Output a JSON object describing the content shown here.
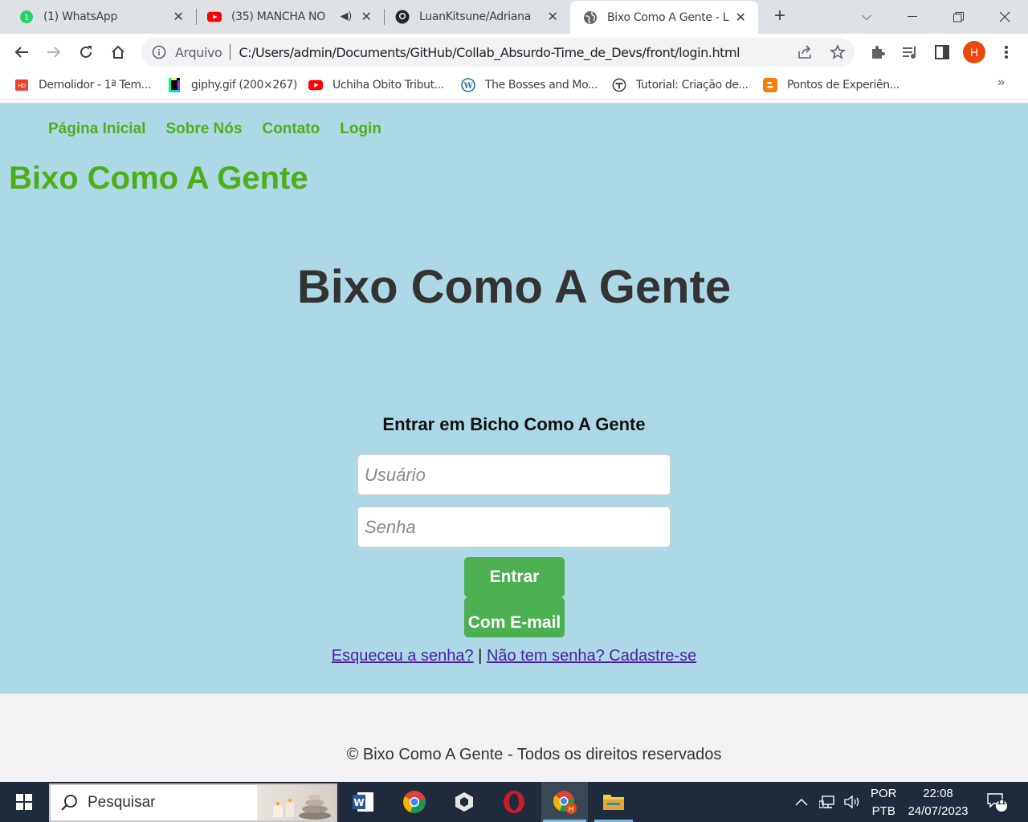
{
  "browser": {
    "tabs": [
      {
        "title": "(1) WhatsApp",
        "icon": "whatsapp-icon",
        "active": false
      },
      {
        "title": "(35) MANCHA NO",
        "icon": "youtube-icon",
        "active": false
      },
      {
        "title": "LuanKitsune/Adriana",
        "icon": "github-icon",
        "active": false
      },
      {
        "title": "Bixo Como A Gente - L",
        "icon": "globe-icon",
        "active": true
      }
    ],
    "address": {
      "scheme_label": "Arquivo",
      "url": "C:/Users/admin/Documents/GitHub/Collab_Absurdo-Time_de_Devs/front/login.html"
    },
    "profile_initial": "H",
    "bookmarks": [
      {
        "label": "Demolidor - 1ª Tem...",
        "icon": "hd-video-icon"
      },
      {
        "label": "giphy.gif (200×267)",
        "icon": "giphy-icon"
      },
      {
        "label": "Uchiha Obito Tribut...",
        "icon": "youtube-icon"
      },
      {
        "label": "The Bosses and Mo...",
        "icon": "wordpress-icon"
      },
      {
        "label": "Tutorial: Criação de...",
        "icon": "tutorial-icon"
      },
      {
        "label": "Pontos de Experiên...",
        "icon": "blogger-icon"
      }
    ],
    "bookmarks_more": "»"
  },
  "page": {
    "nav": [
      "Página Inicial",
      "Sobre Nós",
      "Contato",
      "Login"
    ],
    "brand": "Bixo Como A Gente",
    "hero_title": "Bixo Como A Gente",
    "login": {
      "title": "Entrar em Bicho Como A Gente",
      "username_placeholder": "Usuário",
      "password_placeholder": "Senha",
      "submit_label": "Entrar",
      "email_label": "Com E-mail",
      "forgot_link": "Esqueceu a senha?",
      "separator": "|",
      "signup_link": "Não tem senha? Cadastre-se"
    },
    "footer": "© Bixo Como A Gente - Todos os direitos reservados"
  },
  "taskbar": {
    "search_placeholder": "Pesquisar",
    "apps": [
      "word-icon",
      "chrome-icon",
      "unity-icon",
      "opera-icon",
      "chrome-profile-icon",
      "file-explorer-icon"
    ],
    "lang_line1": "POR",
    "lang_line2": "PTB",
    "time": "22:08",
    "date": "24/07/2023",
    "notification_count": "11"
  },
  "colors": {
    "page_bg": "#add8e6",
    "accent_green": "#4caf1a",
    "button_green": "#4caf50",
    "footer_bg": "#f2f2f2",
    "taskbar_bg": "#1f2b3b"
  }
}
